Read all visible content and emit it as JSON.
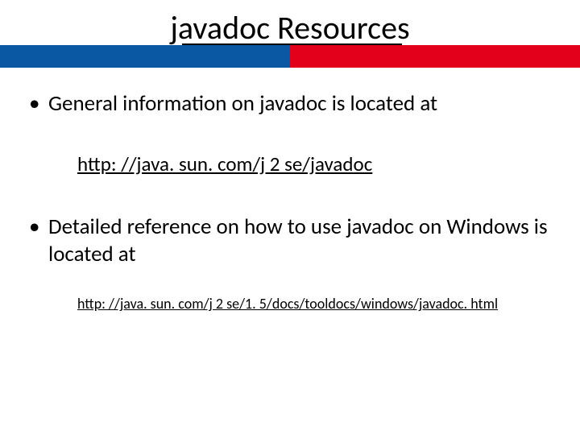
{
  "title": "javadoc Resources",
  "bullets": {
    "b1": "General information on javadoc is located at",
    "b2": "Detailed reference on how to use javadoc on Windows is located at"
  },
  "links": {
    "l1": "http: //java. sun. com/j 2 se/javadoc",
    "l2": "http: //java. sun. com/j 2 se/1. 5/docs/tooldocs/windows/javadoc. html"
  }
}
